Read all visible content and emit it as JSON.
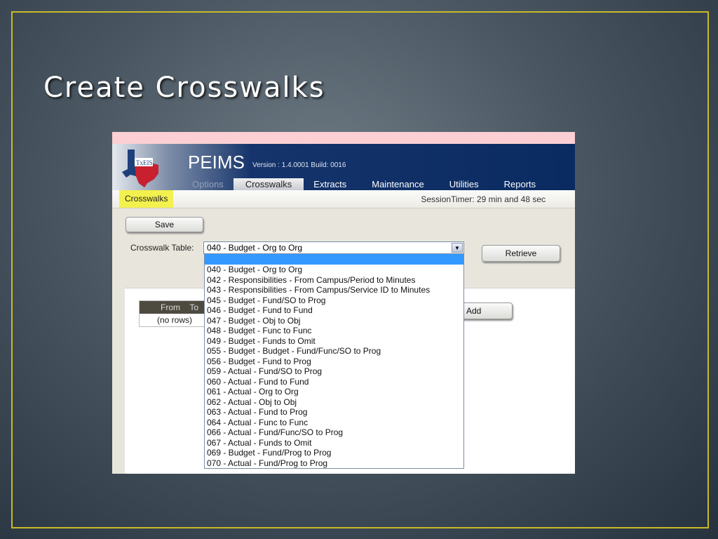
{
  "slide": {
    "title": "Create Crosswalks"
  },
  "app": {
    "name": "PEIMS",
    "version": "Version : 1.4.0001 Build: 0016",
    "logo_text": "TxEIS",
    "tabs": [
      "Options",
      "Crosswalks",
      "Extracts",
      "Maintenance",
      "Utilities",
      "Reports"
    ],
    "breadcrumb": "Crosswalks",
    "session_timer": "SessionTimer: 29 min and 48 sec",
    "save_label": "Save",
    "retrieve_label": "Retrieve",
    "add_label": "Add",
    "crosswalk_label": "Crosswalk Table:",
    "selected": "040 - Budget - Org to Org",
    "table": {
      "headers": [
        "From",
        "To"
      ],
      "empty": "(no rows)"
    },
    "options": [
      "",
      "040 - Budget - Org to Org",
      "042 - Responsibilities - From Campus/Period to Minutes",
      "043 - Responsibilities - From Campus/Service ID to Minutes",
      "045 - Budget - Fund/SO to Prog",
      "046 - Budget - Fund to Fund",
      "047 - Budget - Obj to Obj",
      "048 - Budget - Func to Func",
      "049 - Budget - Funds to Omit",
      "055 - Budget - Budget - Fund/Func/SO to Prog",
      "056 - Budget - Fund to Prog",
      "059 - Actual - Fund/SO to Prog",
      "060 - Actual - Fund to Fund",
      "061 - Actual - Org to Org",
      "062 - Actual - Obj to Obj",
      "063 - Actual - Fund to Prog",
      "064 - Actual - Func to Func",
      "066 - Actual - Fund/Func/SO to Prog",
      "067 - Actual - Funds to Omit",
      "069 - Budget - Fund/Prog to Prog",
      "070 - Actual - Fund/Prog to Prog"
    ]
  }
}
